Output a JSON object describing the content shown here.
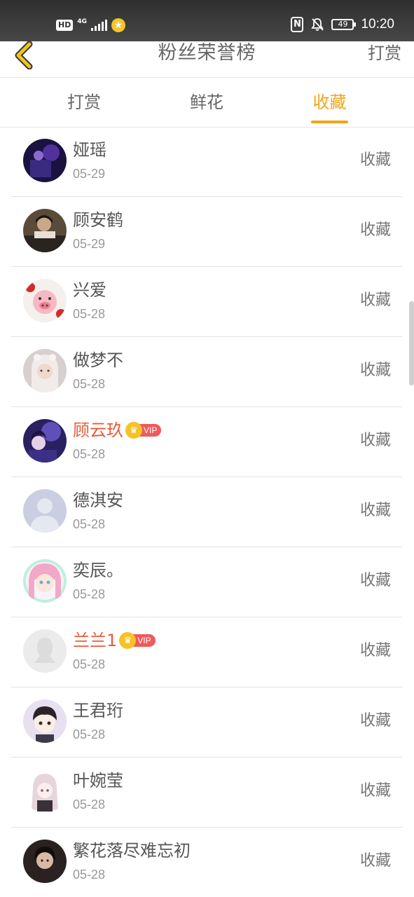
{
  "status_bar": {
    "hd": "HD",
    "network": "4G",
    "battery": "49",
    "time": "10:20"
  },
  "nav": {
    "title": "粉丝荣誉榜",
    "action": "打赏"
  },
  "tabs": [
    {
      "label": "打赏",
      "active": false
    },
    {
      "label": "鲜花",
      "active": false
    },
    {
      "label": "收藏",
      "active": true
    }
  ],
  "vip_label": "VIP",
  "list": [
    {
      "name": "娅瑶",
      "date": "05-29",
      "action": "收藏",
      "vip": false
    },
    {
      "name": "顾安鹤",
      "date": "05-29",
      "action": "收藏",
      "vip": false
    },
    {
      "name": "兴爱",
      "date": "05-28",
      "action": "收藏",
      "vip": false
    },
    {
      "name": "做梦不",
      "date": "05-28",
      "action": "收藏",
      "vip": false
    },
    {
      "name": "顾云玖",
      "date": "05-28",
      "action": "收藏",
      "vip": true
    },
    {
      "name": "德淇安",
      "date": "05-28",
      "action": "收藏",
      "vip": false
    },
    {
      "name": "奕辰。",
      "date": "05-28",
      "action": "收藏",
      "vip": false
    },
    {
      "name": "兰兰1",
      "date": "05-28",
      "action": "收藏",
      "vip": true
    },
    {
      "name": "王君珩",
      "date": "05-28",
      "action": "收藏",
      "vip": false
    },
    {
      "name": "叶婉莹",
      "date": "05-28",
      "action": "收藏",
      "vip": false
    },
    {
      "name": "繁花落尽难忘初",
      "date": "05-28",
      "action": "收藏",
      "vip": false
    }
  ],
  "colors": {
    "accent": "#f2a516",
    "vip_name": "#e85c3a",
    "vip_tag": "#ef5a5a",
    "crown": "#f5c327",
    "back_arrow": "#f0c419"
  }
}
